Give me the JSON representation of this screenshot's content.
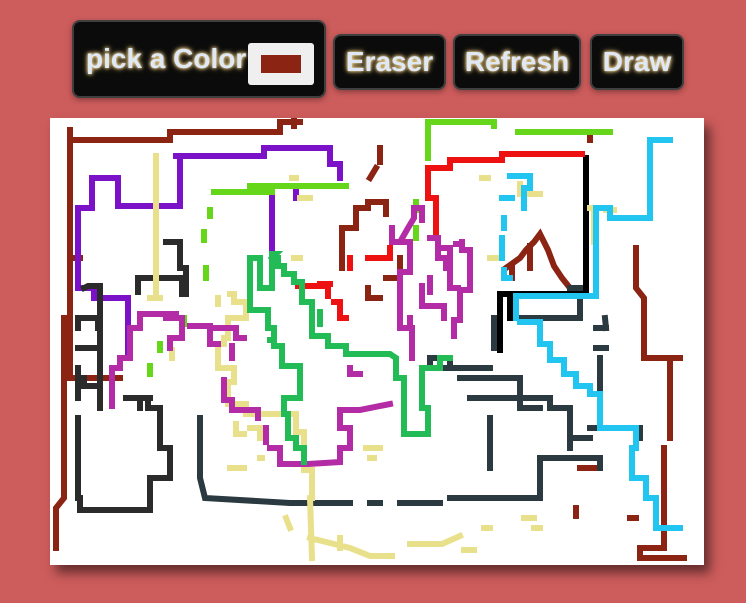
{
  "toolbar": {
    "pick_color_label": "pick a Color",
    "selected_color": "#8b2413",
    "eraser_label": "Eraser",
    "refresh_label": "Refresh",
    "draw_label": "Draw"
  },
  "canvas": {
    "background": "#ffffff"
  },
  "colors": {
    "page_background": "#cd5c5c",
    "button_background": "#0b0b0b",
    "button_text": "#dfe8f4"
  }
}
